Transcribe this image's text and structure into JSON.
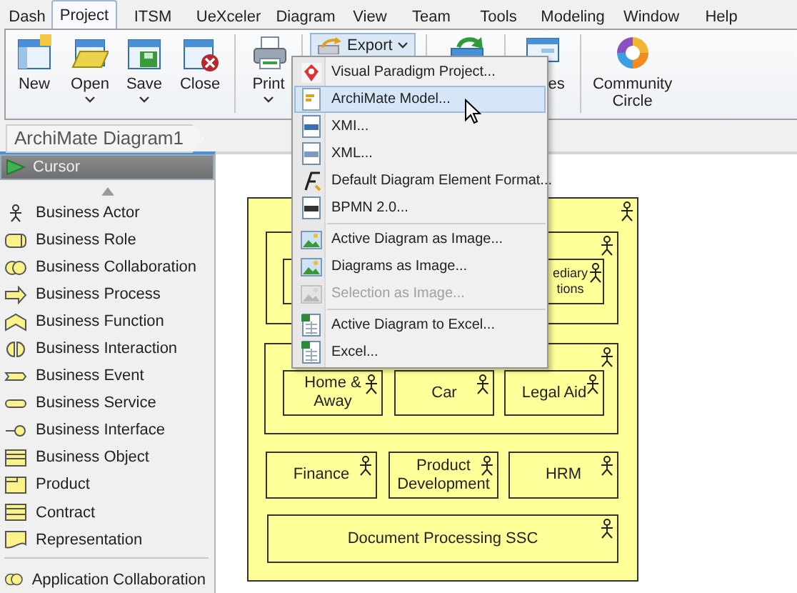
{
  "menu_tabs": [
    {
      "label": "Dash",
      "selected": false
    },
    {
      "label": "Project",
      "selected": true
    },
    {
      "label": "ITSM",
      "selected": false
    },
    {
      "label": "UeXceler",
      "selected": false
    },
    {
      "label": "Diagram",
      "selected": false
    },
    {
      "label": "View",
      "selected": false
    },
    {
      "label": "Team",
      "selected": false
    },
    {
      "label": "Tools",
      "selected": false
    },
    {
      "label": "Modeling",
      "selected": false
    },
    {
      "label": "Window",
      "selected": false
    },
    {
      "label": "Help",
      "selected": false
    }
  ],
  "ribbon": [
    {
      "kind": "new",
      "label": "New",
      "dropdown": false
    },
    {
      "kind": "open",
      "label": "Open",
      "dropdown": true
    },
    {
      "kind": "save",
      "label": "Save",
      "dropdown": true
    },
    {
      "kind": "close",
      "label": "Close",
      "dropdown": false
    },
    {
      "kind": "separator"
    },
    {
      "kind": "print",
      "label": "Print",
      "dropdown": true
    },
    {
      "kind": "separator"
    },
    {
      "kind": "export",
      "label": "Export",
      "dropdown": true,
      "expanded": true
    },
    {
      "kind": "separator"
    },
    {
      "kind": "sync"
    },
    {
      "kind": "separator"
    },
    {
      "kind": "window",
      "label": "es"
    },
    {
      "kind": "separator"
    },
    {
      "kind": "community",
      "label": "Community\nCircle"
    }
  ],
  "export_menu": [
    {
      "kind": "vp",
      "label": "Visual Paradigm Project...",
      "disabled": false,
      "selected": false
    },
    {
      "kind": "archimate",
      "label": "ArchiMate Model...",
      "disabled": false,
      "selected": true
    },
    {
      "kind": "xmi",
      "label": "XMI...",
      "disabled": false,
      "selected": false
    },
    {
      "kind": "xml",
      "label": "XML...",
      "disabled": false,
      "selected": false
    },
    {
      "kind": "format",
      "label": "Default Diagram Element Format...",
      "disabled": false,
      "selected": false
    },
    {
      "kind": "bpmn",
      "label": "BPMN 2.0...",
      "disabled": false,
      "selected": false
    },
    {
      "kind": "separator"
    },
    {
      "kind": "image",
      "label": "Active Diagram as Image...",
      "disabled": false,
      "selected": false
    },
    {
      "kind": "image",
      "label": "Diagrams as Image...",
      "disabled": false,
      "selected": false
    },
    {
      "kind": "image",
      "label": "Selection as Image...",
      "disabled": true,
      "selected": false
    },
    {
      "kind": "separator"
    },
    {
      "kind": "excel",
      "label": "Active Diagram to Excel...",
      "disabled": false,
      "selected": false
    },
    {
      "kind": "excel",
      "label": "Excel...",
      "disabled": false,
      "selected": false
    }
  ],
  "breadcrumb": "ArchiMate Diagram1",
  "palette": {
    "header": "Cursor",
    "items": [
      {
        "kind": "actor",
        "label": "Business Actor"
      },
      {
        "kind": "role",
        "label": "Business Role"
      },
      {
        "kind": "collaboration",
        "label": "Business Collaboration"
      },
      {
        "kind": "process",
        "label": "Business Process"
      },
      {
        "kind": "function",
        "label": "Business Function"
      },
      {
        "kind": "interaction",
        "label": "Business Interaction"
      },
      {
        "kind": "event",
        "label": "Business Event"
      },
      {
        "kind": "service",
        "label": "Business Service"
      },
      {
        "kind": "interface",
        "label": "Business Interface"
      },
      {
        "kind": "object",
        "label": "Business Object"
      },
      {
        "kind": "product",
        "label": "Product"
      },
      {
        "kind": "contract",
        "label": "Contract"
      },
      {
        "kind": "representation",
        "label": "Representation"
      },
      {
        "kind": "separator"
      },
      {
        "kind": "collaboration",
        "label": "Application Collaboration"
      }
    ]
  },
  "diagram": {
    "nodes": [
      {
        "children": [
          {
            "children": [
              {
                "label": "ediary\ntions"
              }
            ]
          },
          {
            "children": [
              {
                "label": "Home &\nAway"
              },
              {
                "label": "Car"
              },
              {
                "label": "Legal Aid"
              }
            ]
          },
          {
            "label": "Finance"
          },
          {
            "label": "Product\nDevelopment"
          },
          {
            "label": "HRM"
          },
          {
            "label": "Document Processing SSC"
          }
        ]
      }
    ]
  }
}
